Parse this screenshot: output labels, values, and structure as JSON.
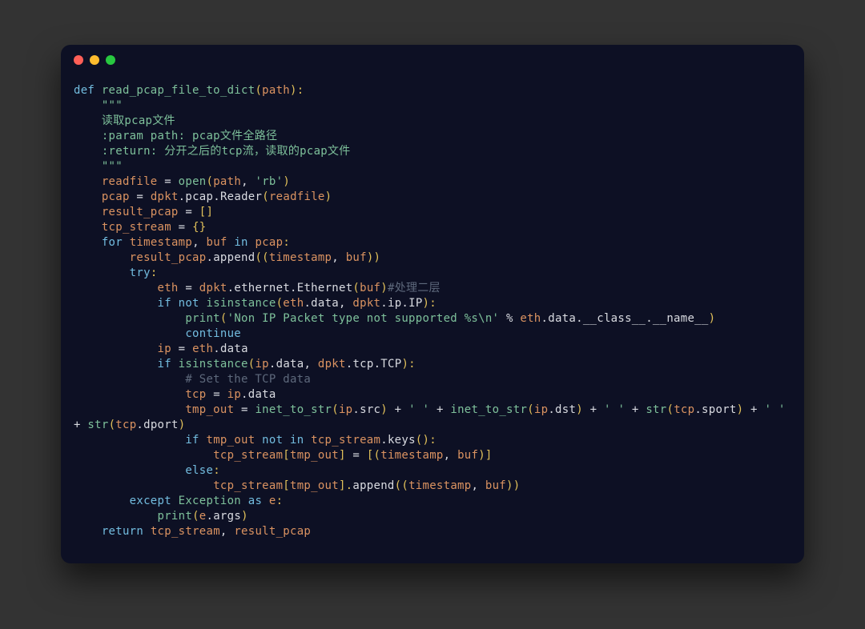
{
  "window": {
    "system": "macOS"
  },
  "colors": {
    "bg": "#0d1024",
    "text": "#d9dbe1",
    "keyword": "#73bde0",
    "funcname": "#7ec19b",
    "param": "#db9361",
    "docstring": "#7ec19b",
    "builtin": "#7ec19b",
    "string": "#7ec19b",
    "comment": "#5e697c",
    "punct": "#e2c15a",
    "number": "#d9dbe1"
  },
  "tokens": [
    [
      {
        "t": "def ",
        "c": "#73bde0"
      },
      {
        "t": "read_pcap_file_to_dict",
        "c": "#7ec19b"
      },
      {
        "t": "(",
        "c": "#e2c15a"
      },
      {
        "t": "path",
        "c": "#db9361"
      },
      {
        "t": "):",
        "c": "#e2c15a"
      }
    ],
    [
      {
        "t": "    \"\"\"",
        "c": "#7ec19b"
      }
    ],
    [
      {
        "t": "    读取pcap文件",
        "c": "#7ec19b"
      }
    ],
    [
      {
        "t": "    :param path: pcap文件全路径",
        "c": "#7ec19b"
      }
    ],
    [
      {
        "t": "    :return: 分开之后的tcp流，读取的pcap文件",
        "c": "#7ec19b"
      }
    ],
    [
      {
        "t": "    \"\"\"",
        "c": "#7ec19b"
      }
    ],
    [
      {
        "t": "    ",
        "c": "#d9dbe1"
      },
      {
        "t": "readfile",
        "c": "#db9361"
      },
      {
        "t": " = ",
        "c": "#d9dbe1"
      },
      {
        "t": "open",
        "c": "#7ec19b"
      },
      {
        "t": "(",
        "c": "#e2c15a"
      },
      {
        "t": "path",
        "c": "#db9361"
      },
      {
        "t": ", ",
        "c": "#d9dbe1"
      },
      {
        "t": "'rb'",
        "c": "#7ec19b"
      },
      {
        "t": ")",
        "c": "#e2c15a"
      }
    ],
    [
      {
        "t": "    ",
        "c": "#d9dbe1"
      },
      {
        "t": "pcap",
        "c": "#db9361"
      },
      {
        "t": " = ",
        "c": "#d9dbe1"
      },
      {
        "t": "dpkt",
        "c": "#db9361"
      },
      {
        "t": ".",
        "c": "#d9dbe1"
      },
      {
        "t": "pcap",
        "c": "#d9dbe1"
      },
      {
        "t": ".",
        "c": "#d9dbe1"
      },
      {
        "t": "Reader",
        "c": "#d9dbe1"
      },
      {
        "t": "(",
        "c": "#e2c15a"
      },
      {
        "t": "readfile",
        "c": "#db9361"
      },
      {
        "t": ")",
        "c": "#e2c15a"
      }
    ],
    [
      {
        "t": "    ",
        "c": "#d9dbe1"
      },
      {
        "t": "result_pcap",
        "c": "#db9361"
      },
      {
        "t": " = ",
        "c": "#d9dbe1"
      },
      {
        "t": "[]",
        "c": "#e2c15a"
      }
    ],
    [
      {
        "t": "    ",
        "c": "#d9dbe1"
      },
      {
        "t": "tcp_stream",
        "c": "#db9361"
      },
      {
        "t": " = ",
        "c": "#d9dbe1"
      },
      {
        "t": "{}",
        "c": "#e2c15a"
      }
    ],
    [
      {
        "t": "    ",
        "c": "#d9dbe1"
      },
      {
        "t": "for ",
        "c": "#73bde0"
      },
      {
        "t": "timestamp",
        "c": "#db9361"
      },
      {
        "t": ", ",
        "c": "#d9dbe1"
      },
      {
        "t": "buf",
        "c": "#db9361"
      },
      {
        "t": " in ",
        "c": "#73bde0"
      },
      {
        "t": "pcap",
        "c": "#db9361"
      },
      {
        "t": ":",
        "c": "#e2c15a"
      }
    ],
    [
      {
        "t": "        ",
        "c": "#d9dbe1"
      },
      {
        "t": "result_pcap",
        "c": "#db9361"
      },
      {
        "t": ".",
        "c": "#d9dbe1"
      },
      {
        "t": "append",
        "c": "#d9dbe1"
      },
      {
        "t": "((",
        "c": "#e2c15a"
      },
      {
        "t": "timestamp",
        "c": "#db9361"
      },
      {
        "t": ", ",
        "c": "#d9dbe1"
      },
      {
        "t": "buf",
        "c": "#db9361"
      },
      {
        "t": "))",
        "c": "#e2c15a"
      }
    ],
    [
      {
        "t": "        ",
        "c": "#d9dbe1"
      },
      {
        "t": "try",
        "c": "#73bde0"
      },
      {
        "t": ":",
        "c": "#e2c15a"
      }
    ],
    [
      {
        "t": "            ",
        "c": "#d9dbe1"
      },
      {
        "t": "eth",
        "c": "#db9361"
      },
      {
        "t": " = ",
        "c": "#d9dbe1"
      },
      {
        "t": "dpkt",
        "c": "#db9361"
      },
      {
        "t": ".",
        "c": "#d9dbe1"
      },
      {
        "t": "ethernet",
        "c": "#d9dbe1"
      },
      {
        "t": ".",
        "c": "#d9dbe1"
      },
      {
        "t": "Ethernet",
        "c": "#d9dbe1"
      },
      {
        "t": "(",
        "c": "#e2c15a"
      },
      {
        "t": "buf",
        "c": "#db9361"
      },
      {
        "t": ")",
        "c": "#e2c15a"
      },
      {
        "t": "#处理二层",
        "c": "#5e697c"
      }
    ],
    [
      {
        "t": "            ",
        "c": "#d9dbe1"
      },
      {
        "t": "if not ",
        "c": "#73bde0"
      },
      {
        "t": "isinstance",
        "c": "#7ec19b"
      },
      {
        "t": "(",
        "c": "#e2c15a"
      },
      {
        "t": "eth",
        "c": "#db9361"
      },
      {
        "t": ".",
        "c": "#d9dbe1"
      },
      {
        "t": "data",
        "c": "#d9dbe1"
      },
      {
        "t": ", ",
        "c": "#d9dbe1"
      },
      {
        "t": "dpkt",
        "c": "#db9361"
      },
      {
        "t": ".",
        "c": "#d9dbe1"
      },
      {
        "t": "ip",
        "c": "#d9dbe1"
      },
      {
        "t": ".",
        "c": "#d9dbe1"
      },
      {
        "t": "IP",
        "c": "#d9dbe1"
      },
      {
        "t": "):",
        "c": "#e2c15a"
      }
    ],
    [
      {
        "t": "                ",
        "c": "#d9dbe1"
      },
      {
        "t": "print",
        "c": "#7ec19b"
      },
      {
        "t": "(",
        "c": "#e2c15a"
      },
      {
        "t": "'Non IP Packet type not supported %s\\n'",
        "c": "#7ec19b"
      },
      {
        "t": " % ",
        "c": "#d9dbe1"
      },
      {
        "t": "eth",
        "c": "#db9361"
      },
      {
        "t": ".",
        "c": "#d9dbe1"
      },
      {
        "t": "data",
        "c": "#d9dbe1"
      },
      {
        "t": ".",
        "c": "#d9dbe1"
      },
      {
        "t": "__class__",
        "c": "#d9dbe1"
      },
      {
        "t": ".",
        "c": "#d9dbe1"
      },
      {
        "t": "__name__",
        "c": "#d9dbe1"
      },
      {
        "t": ")",
        "c": "#e2c15a"
      }
    ],
    [
      {
        "t": "                ",
        "c": "#d9dbe1"
      },
      {
        "t": "continue",
        "c": "#73bde0"
      }
    ],
    [
      {
        "t": "            ",
        "c": "#d9dbe1"
      },
      {
        "t": "ip",
        "c": "#db9361"
      },
      {
        "t": " = ",
        "c": "#d9dbe1"
      },
      {
        "t": "eth",
        "c": "#db9361"
      },
      {
        "t": ".",
        "c": "#d9dbe1"
      },
      {
        "t": "data",
        "c": "#d9dbe1"
      }
    ],
    [
      {
        "t": "            ",
        "c": "#d9dbe1"
      },
      {
        "t": "if ",
        "c": "#73bde0"
      },
      {
        "t": "isinstance",
        "c": "#7ec19b"
      },
      {
        "t": "(",
        "c": "#e2c15a"
      },
      {
        "t": "ip",
        "c": "#db9361"
      },
      {
        "t": ".",
        "c": "#d9dbe1"
      },
      {
        "t": "data",
        "c": "#d9dbe1"
      },
      {
        "t": ", ",
        "c": "#d9dbe1"
      },
      {
        "t": "dpkt",
        "c": "#db9361"
      },
      {
        "t": ".",
        "c": "#d9dbe1"
      },
      {
        "t": "tcp",
        "c": "#d9dbe1"
      },
      {
        "t": ".",
        "c": "#d9dbe1"
      },
      {
        "t": "TCP",
        "c": "#d9dbe1"
      },
      {
        "t": "):",
        "c": "#e2c15a"
      }
    ],
    [
      {
        "t": "                ",
        "c": "#d9dbe1"
      },
      {
        "t": "# Set the TCP data",
        "c": "#5e697c"
      }
    ],
    [
      {
        "t": "                ",
        "c": "#d9dbe1"
      },
      {
        "t": "tcp",
        "c": "#db9361"
      },
      {
        "t": " = ",
        "c": "#d9dbe1"
      },
      {
        "t": "ip",
        "c": "#db9361"
      },
      {
        "t": ".",
        "c": "#d9dbe1"
      },
      {
        "t": "data",
        "c": "#d9dbe1"
      }
    ],
    [
      {
        "t": "                ",
        "c": "#d9dbe1"
      },
      {
        "t": "tmp_out",
        "c": "#db9361"
      },
      {
        "t": " = ",
        "c": "#d9dbe1"
      },
      {
        "t": "inet_to_str",
        "c": "#7ec19b"
      },
      {
        "t": "(",
        "c": "#e2c15a"
      },
      {
        "t": "ip",
        "c": "#db9361"
      },
      {
        "t": ".",
        "c": "#d9dbe1"
      },
      {
        "t": "src",
        "c": "#d9dbe1"
      },
      {
        "t": ")",
        "c": "#e2c15a"
      },
      {
        "t": " + ",
        "c": "#d9dbe1"
      },
      {
        "t": "' '",
        "c": "#7ec19b"
      },
      {
        "t": " + ",
        "c": "#d9dbe1"
      },
      {
        "t": "inet_to_str",
        "c": "#7ec19b"
      },
      {
        "t": "(",
        "c": "#e2c15a"
      },
      {
        "t": "ip",
        "c": "#db9361"
      },
      {
        "t": ".",
        "c": "#d9dbe1"
      },
      {
        "t": "dst",
        "c": "#d9dbe1"
      },
      {
        "t": ")",
        "c": "#e2c15a"
      },
      {
        "t": " + ",
        "c": "#d9dbe1"
      },
      {
        "t": "' '",
        "c": "#7ec19b"
      },
      {
        "t": " + ",
        "c": "#d9dbe1"
      },
      {
        "t": "str",
        "c": "#7ec19b"
      },
      {
        "t": "(",
        "c": "#e2c15a"
      },
      {
        "t": "tcp",
        "c": "#db9361"
      },
      {
        "t": ".",
        "c": "#d9dbe1"
      },
      {
        "t": "sport",
        "c": "#d9dbe1"
      },
      {
        "t": ")",
        "c": "#e2c15a"
      },
      {
        "t": " + ",
        "c": "#d9dbe1"
      },
      {
        "t": "' '",
        "c": "#7ec19b"
      },
      {
        "t": " + ",
        "c": "#d9dbe1"
      },
      {
        "t": "str",
        "c": "#7ec19b"
      },
      {
        "t": "(",
        "c": "#e2c15a"
      },
      {
        "t": "tcp",
        "c": "#db9361"
      },
      {
        "t": ".",
        "c": "#d9dbe1"
      },
      {
        "t": "dport",
        "c": "#d9dbe1"
      },
      {
        "t": ")",
        "c": "#e2c15a"
      }
    ],
    [
      {
        "t": "                ",
        "c": "#d9dbe1"
      },
      {
        "t": "if ",
        "c": "#73bde0"
      },
      {
        "t": "tmp_out",
        "c": "#db9361"
      },
      {
        "t": " not in ",
        "c": "#73bde0"
      },
      {
        "t": "tcp_stream",
        "c": "#db9361"
      },
      {
        "t": ".",
        "c": "#d9dbe1"
      },
      {
        "t": "keys",
        "c": "#d9dbe1"
      },
      {
        "t": "():",
        "c": "#e2c15a"
      }
    ],
    [
      {
        "t": "                    ",
        "c": "#d9dbe1"
      },
      {
        "t": "tcp_stream",
        "c": "#db9361"
      },
      {
        "t": "[",
        "c": "#e2c15a"
      },
      {
        "t": "tmp_out",
        "c": "#db9361"
      },
      {
        "t": "]",
        "c": "#e2c15a"
      },
      {
        "t": " = ",
        "c": "#d9dbe1"
      },
      {
        "t": "[(",
        "c": "#e2c15a"
      },
      {
        "t": "timestamp",
        "c": "#db9361"
      },
      {
        "t": ", ",
        "c": "#d9dbe1"
      },
      {
        "t": "buf",
        "c": "#db9361"
      },
      {
        "t": ")]",
        "c": "#e2c15a"
      }
    ],
    [
      {
        "t": "                ",
        "c": "#d9dbe1"
      },
      {
        "t": "else",
        "c": "#73bde0"
      },
      {
        "t": ":",
        "c": "#e2c15a"
      }
    ],
    [
      {
        "t": "                    ",
        "c": "#d9dbe1"
      },
      {
        "t": "tcp_stream",
        "c": "#db9361"
      },
      {
        "t": "[",
        "c": "#e2c15a"
      },
      {
        "t": "tmp_out",
        "c": "#db9361"
      },
      {
        "t": "].",
        "c": "#e2c15a"
      },
      {
        "t": "append",
        "c": "#d9dbe1"
      },
      {
        "t": "((",
        "c": "#e2c15a"
      },
      {
        "t": "timestamp",
        "c": "#db9361"
      },
      {
        "t": ", ",
        "c": "#d9dbe1"
      },
      {
        "t": "buf",
        "c": "#db9361"
      },
      {
        "t": "))",
        "c": "#e2c15a"
      }
    ],
    [
      {
        "t": "        ",
        "c": "#d9dbe1"
      },
      {
        "t": "except ",
        "c": "#73bde0"
      },
      {
        "t": "Exception",
        "c": "#7ec19b"
      },
      {
        "t": " as ",
        "c": "#73bde0"
      },
      {
        "t": "e",
        "c": "#db9361"
      },
      {
        "t": ":",
        "c": "#e2c15a"
      }
    ],
    [
      {
        "t": "            ",
        "c": "#d9dbe1"
      },
      {
        "t": "print",
        "c": "#7ec19b"
      },
      {
        "t": "(",
        "c": "#e2c15a"
      },
      {
        "t": "e",
        "c": "#db9361"
      },
      {
        "t": ".",
        "c": "#d9dbe1"
      },
      {
        "t": "args",
        "c": "#d9dbe1"
      },
      {
        "t": ")",
        "c": "#e2c15a"
      }
    ],
    [
      {
        "t": "    ",
        "c": "#d9dbe1"
      },
      {
        "t": "return ",
        "c": "#73bde0"
      },
      {
        "t": "tcp_stream",
        "c": "#db9361"
      },
      {
        "t": ", ",
        "c": "#d9dbe1"
      },
      {
        "t": "result_pcap",
        "c": "#db9361"
      }
    ]
  ]
}
